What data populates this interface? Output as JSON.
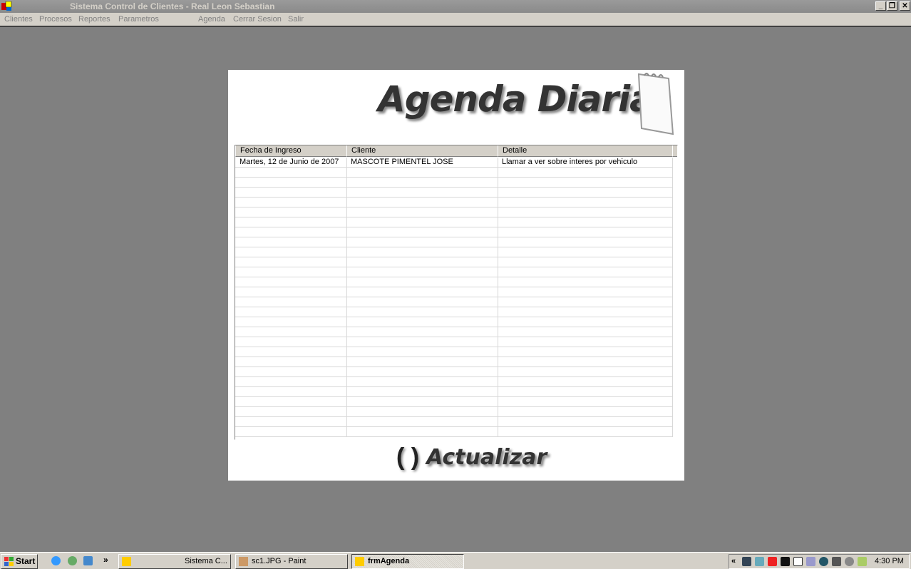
{
  "window": {
    "title": "Sistema Control de Clientes - Real Leon Sebastian",
    "minimize": "_",
    "restore": "❐",
    "close": "✕"
  },
  "menu": [
    "Clientes",
    "Procesos",
    "Reportes",
    "Parametros",
    "Agenda",
    "Cerrar Sesion",
    "Salir"
  ],
  "form": {
    "heading": "Agenda Diaria",
    "refresh_label": "Actualizar",
    "refresh_icon": "refresh-icon"
  },
  "grid": {
    "columns": [
      "Fecha de Ingreso",
      "Cliente",
      "Detalle"
    ],
    "rows": [
      [
        "Martes, 12 de Junio de 2007",
        "MASCOTE PIMENTEL JOSE",
        "Llamar a ver sobre interes por vehiculo"
      ]
    ]
  },
  "taskbar": {
    "start": "Start",
    "quicklaunch_more": "»",
    "items": [
      {
        "label": "Sistema C...",
        "active": false
      },
      {
        "label": "sc1.JPG - Paint",
        "active": false
      },
      {
        "label": "frmAgenda",
        "active": true
      }
    ],
    "tray_expand": "«",
    "clock": "4:30 PM"
  }
}
